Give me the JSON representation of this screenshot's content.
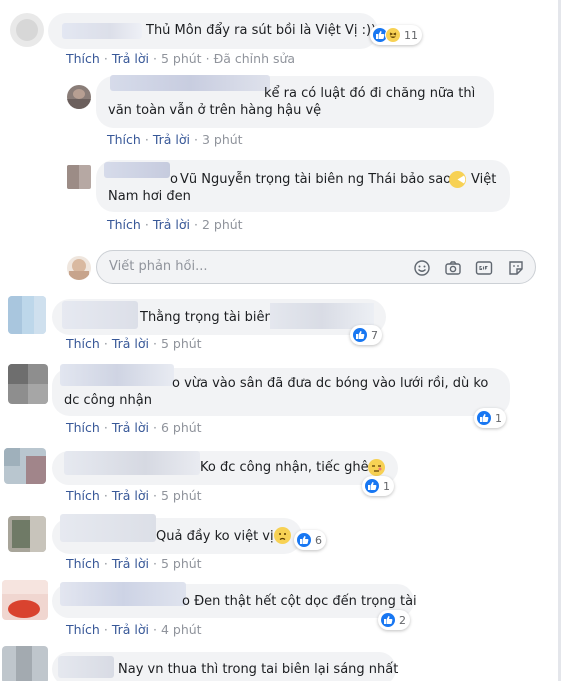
{
  "actions": {
    "like": "Thích",
    "reply": "Trả lời",
    "sep": "·"
  },
  "reply_input": {
    "placeholder": "Viết phản hồi..."
  },
  "comments": [
    {
      "text": "Thủ Môn đẩy ra sút bồi là Việt Vị :))",
      "reactions": [
        "like",
        "haha"
      ],
      "count": "11",
      "time": "5 phút",
      "edited": "Đã chỉnh sửa"
    },
    {
      "text_line1": "kể ra có luật đó đi chăng nữa thì",
      "text_line2": "văn toàn vẫn ở trên hàng hậu vệ",
      "time": "3 phút"
    },
    {
      "text_prefix": "o",
      "text_line1": "Vũ Nguyễn trọng tài biên ng Thái bảo sao",
      "text_line1_tail": "Việt",
      "text_line2": "Nam hơi đen",
      "time": "2 phút"
    },
    {
      "text": "Thằng trọng tài biên",
      "reactions": [
        "like"
      ],
      "count": "7",
      "time": "5 phút"
    },
    {
      "text_line1": "o vừa vào sân đã đưa dc bóng vào lưới rồi, dù ko",
      "text_line2": "dc công nhận",
      "reactions": [
        "like"
      ],
      "count": "1",
      "time": "6 phút"
    },
    {
      "text": "Ko đc công nhận, tiếc ghê",
      "reactions": [
        "like"
      ],
      "count": "1",
      "time": "5 phút"
    },
    {
      "text": "Quả đầy ko việt vị",
      "reactions": [
        "like"
      ],
      "count": "6",
      "time": "5 phút"
    },
    {
      "text": "o Đen thật hết cột dọc đến trọng tài",
      "reactions": [
        "like"
      ],
      "count": "2",
      "time": "4 phút"
    },
    {
      "text": "Nay vn thua thì trong tai biên lại sáng nhất"
    }
  ],
  "colors": {
    "link": "#385898",
    "muted": "#90949c",
    "bubble": "#f2f3f5",
    "like_blue": "#1877f2",
    "emoji_yellow": "#f7d154"
  },
  "icons": [
    "like-icon",
    "haha-icon",
    "emoji-icon",
    "camera-icon",
    "gif-icon",
    "sticker-icon"
  ]
}
